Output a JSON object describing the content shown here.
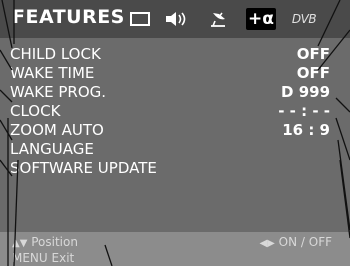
{
  "header": {
    "title": "FEATURES",
    "icons": [
      "screen-icon",
      "speaker-icon",
      "satellite-icon",
      "features-icon",
      "dvb-icon"
    ],
    "dvb_label": "DVB",
    "features_label": "+α"
  },
  "menu": {
    "items": [
      {
        "label": "CHILD LOCK",
        "value": "OFF"
      },
      {
        "label": "WAKE TIME",
        "value": "OFF"
      },
      {
        "label": "WAKE PROG.",
        "value": "D 999"
      },
      {
        "label": "CLOCK",
        "value": "- - : - -"
      },
      {
        "label": "ZOOM AUTO",
        "value": "16 : 9"
      },
      {
        "label": "LANGUAGE",
        "value": ""
      },
      {
        "label": "SOFTWARE UPDATE",
        "value": ""
      }
    ]
  },
  "footer": {
    "position_label": "Position",
    "onoff_label": "ON / OFF",
    "menu_key": "MENU",
    "exit_label": "Exit"
  },
  "colors": {
    "header_bg": "#4a4a4a",
    "menu_bg": "#6b6b6b",
    "footer_bg": "#8c8c8c",
    "text": "#ffffff"
  }
}
